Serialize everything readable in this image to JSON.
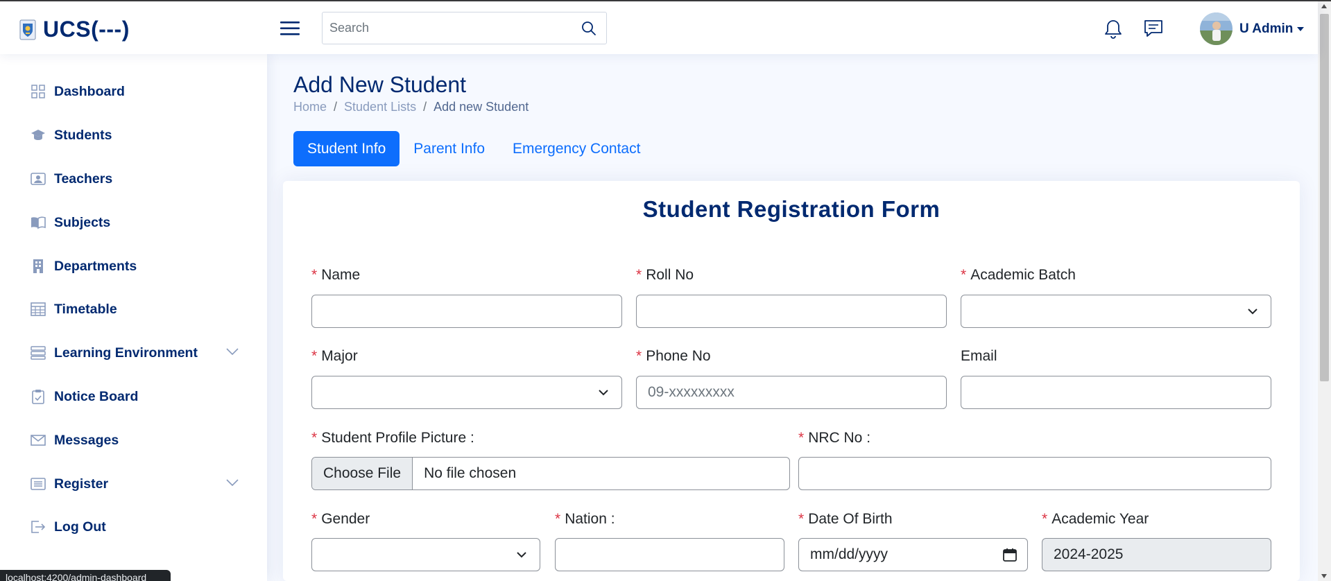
{
  "header": {
    "brand": "UCS(---)",
    "search": {
      "placeholder": "Search",
      "value": ""
    },
    "user_name": "U Admin"
  },
  "sidebar": {
    "items": [
      {
        "label": "Dashboard",
        "icon": "grid-icon"
      },
      {
        "label": "Students",
        "icon": "mortarboard-icon"
      },
      {
        "label": "Teachers",
        "icon": "person-badge-icon"
      },
      {
        "label": "Subjects",
        "icon": "book-icon"
      },
      {
        "label": "Departments",
        "icon": "building-icon"
      },
      {
        "label": "Timetable",
        "icon": "table-icon"
      },
      {
        "label": "Learning Environment",
        "icon": "server-icon",
        "expandable": true
      },
      {
        "label": "Notice Board",
        "icon": "clipboard-icon"
      },
      {
        "label": "Messages",
        "icon": "envelope-icon"
      },
      {
        "label": "Register",
        "icon": "list-icon",
        "expandable": true
      },
      {
        "label": "Log Out",
        "icon": "logout-icon"
      }
    ]
  },
  "status_url": "localhost:4200/admin-dashboard",
  "page": {
    "title": "Add New Student",
    "breadcrumb": [
      "Home",
      "/",
      "Student Lists",
      "/",
      "Add new Student"
    ],
    "tabs": [
      "Student Info",
      "Parent Info",
      "Emergency Contact"
    ],
    "active_tab": "Student Info"
  },
  "form": {
    "title": "Student Registration Form",
    "required_mark": "*",
    "fields": {
      "name": {
        "label": "Name",
        "value": ""
      },
      "roll_no": {
        "label": "Roll No",
        "value": ""
      },
      "academic_batch": {
        "label": "Academic Batch",
        "value": ""
      },
      "major": {
        "label": "Major",
        "value": ""
      },
      "phone_no": {
        "label": "Phone No",
        "placeholder": "09-xxxxxxxxx"
      },
      "email": {
        "label": "Email",
        "value": ""
      },
      "profile_picture": {
        "label": "Student Profile Picture :",
        "button": "Choose File",
        "file_status": "No file chosen"
      },
      "nrc_no": {
        "label": "NRC No :",
        "value": ""
      },
      "gender": {
        "label": "Gender",
        "value": ""
      },
      "nation": {
        "label": "Nation :",
        "value": ""
      },
      "date_of_birth": {
        "label": "Date Of Birth",
        "placeholder": "mm/dd/yyyy"
      },
      "academic_year": {
        "label": "Academic Year",
        "value": "2024-2025"
      }
    }
  },
  "colors": {
    "primary": "#0d6efd",
    "navy": "#012970",
    "required": "#dc3545",
    "page_bg": "#f6f9ff"
  }
}
